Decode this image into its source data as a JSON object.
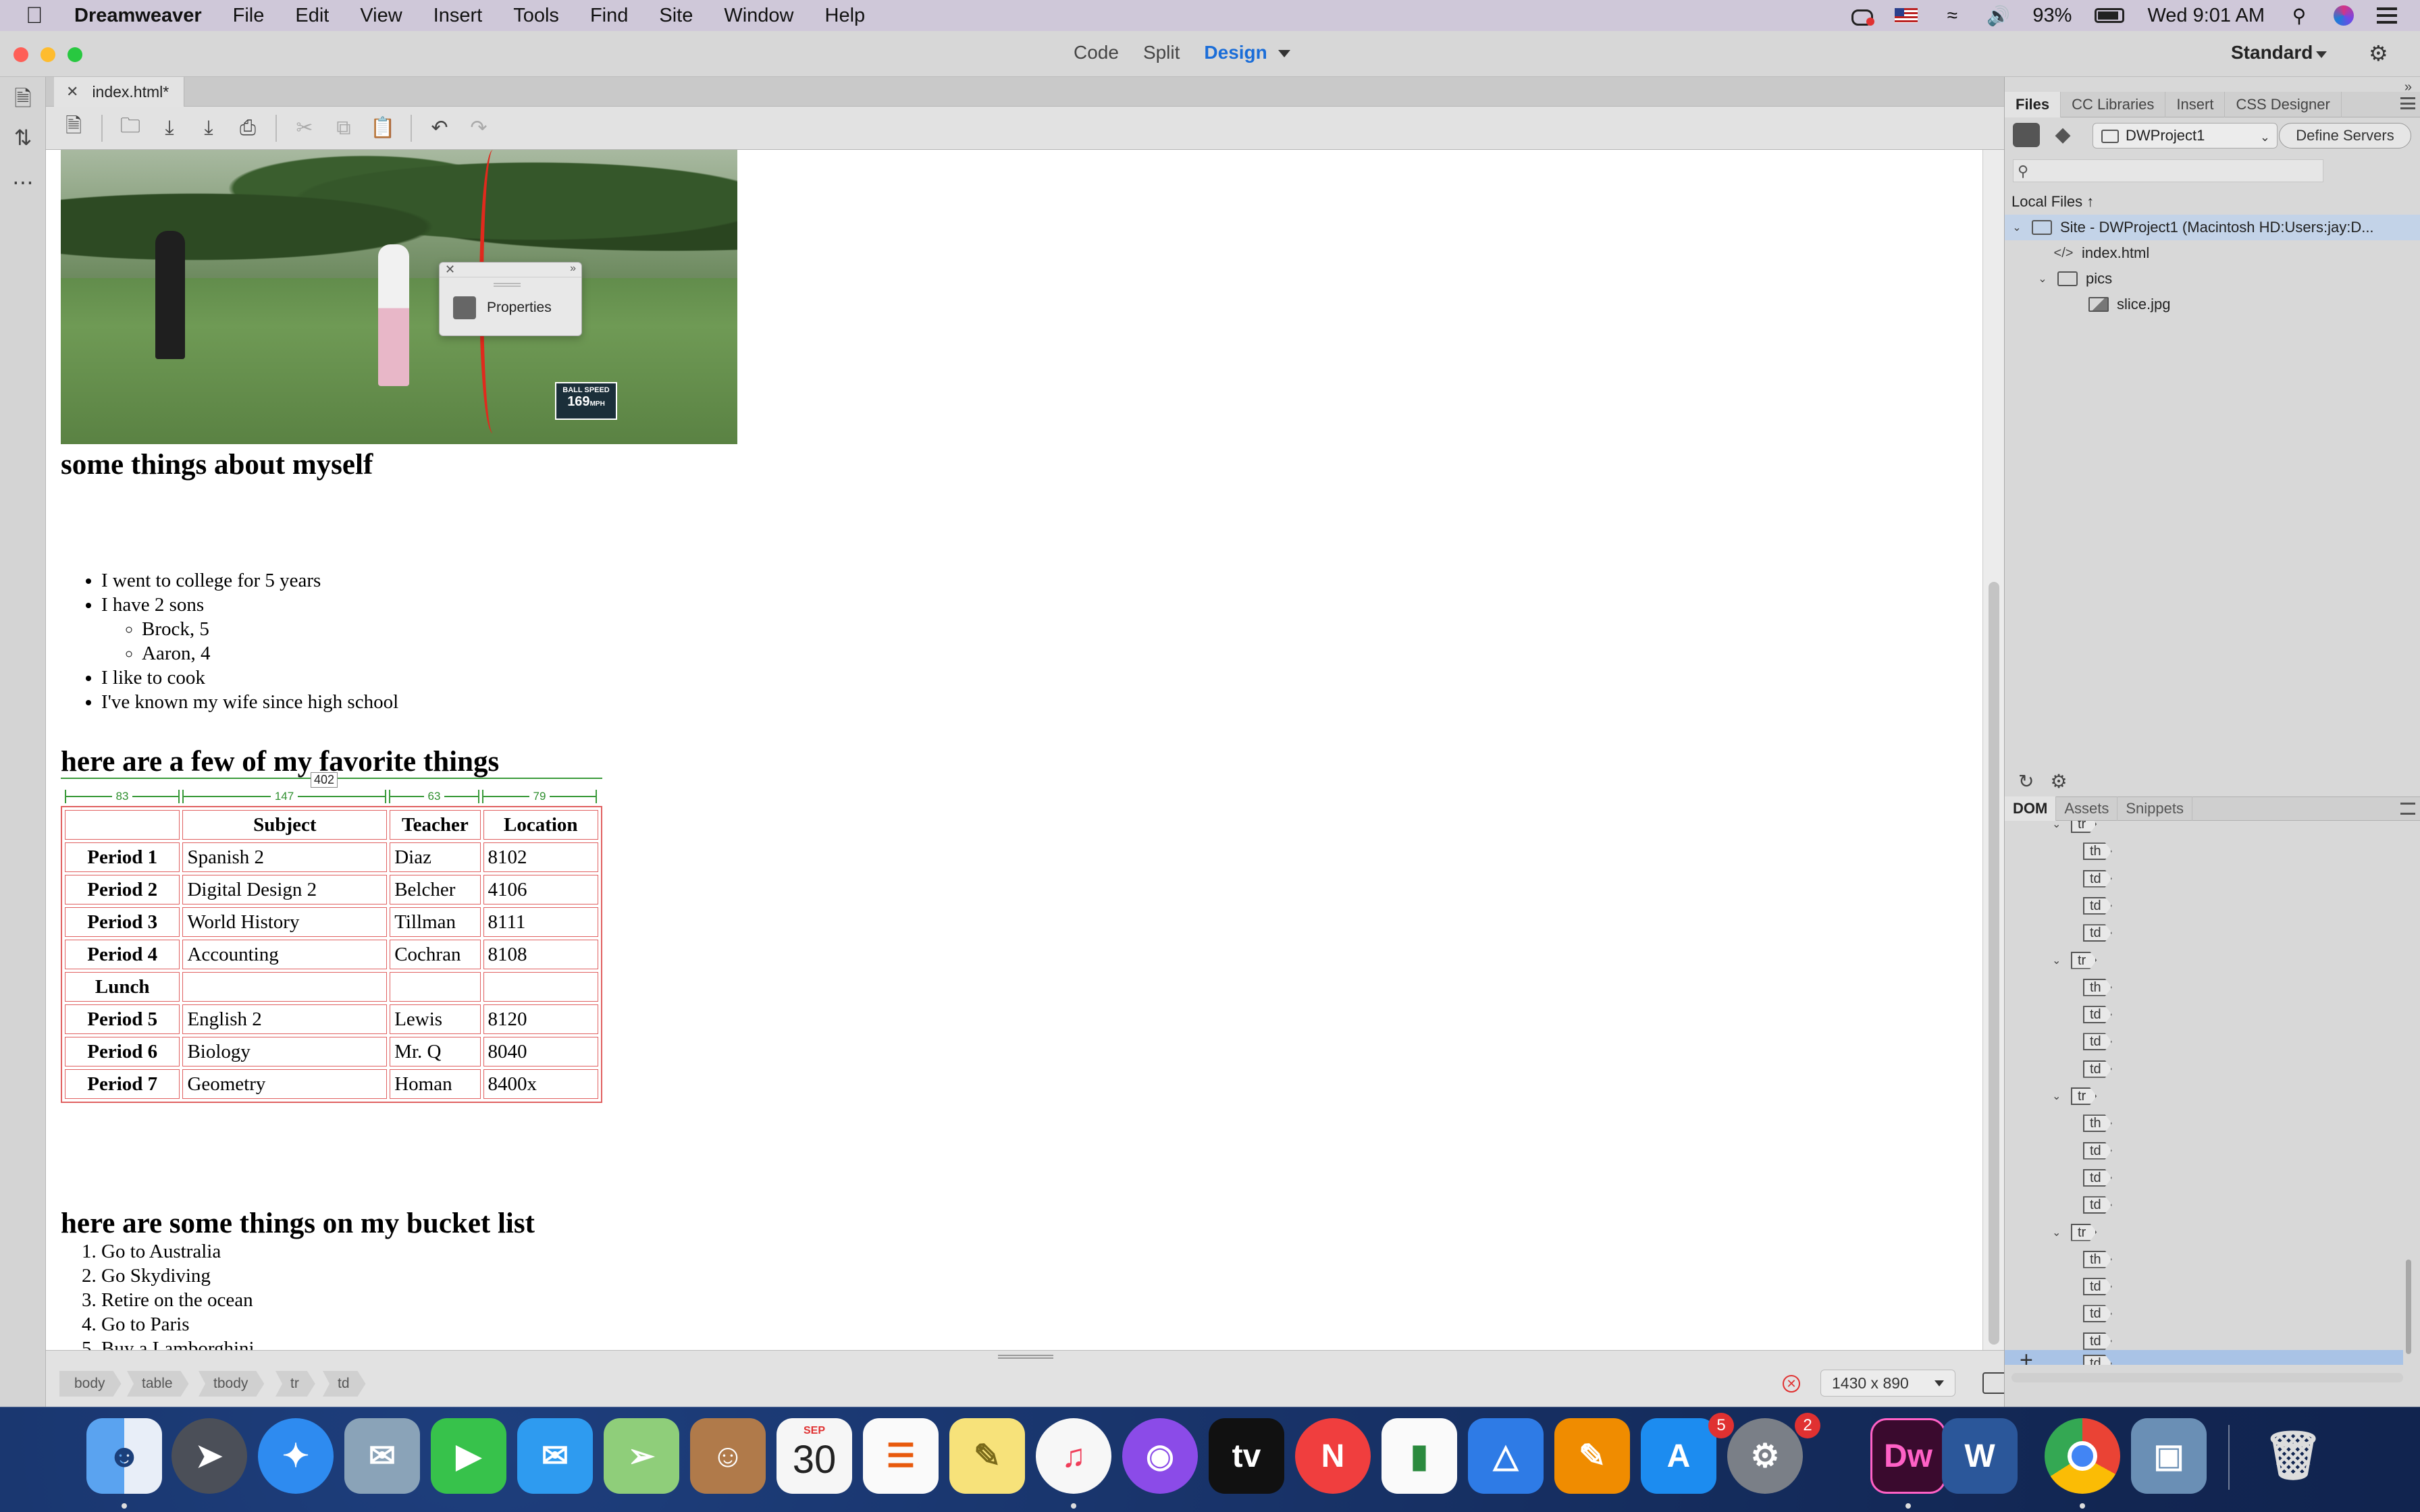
{
  "menubar": {
    "app": "Dreamweaver",
    "items": [
      "File",
      "Edit",
      "View",
      "Insert",
      "Tools",
      "Find",
      "Site",
      "Window",
      "Help"
    ],
    "battery": "93%",
    "clock": "Wed 9:01 AM"
  },
  "titlebar": {
    "views": [
      "Code",
      "Split",
      "Design"
    ],
    "active_view": "Design",
    "workspace": "Standard"
  },
  "document": {
    "tab_label": "index.html*",
    "photo": {
      "speed_label": "BALL SPEED",
      "speed_value": "169",
      "speed_unit": "MPH"
    },
    "properties_label": "Properties",
    "heading1": "some things about myself",
    "about_list": [
      "I went to college for 5 years",
      "I have 2 sons",
      "Brock, 5",
      "Aaron, 4",
      "I like to cook",
      "I've known my wife since high school"
    ],
    "heading2": "here are a few of my favorite things",
    "table_guide": {
      "total": "402",
      "col_widths": [
        "83",
        "147",
        "63",
        "79"
      ]
    },
    "table": {
      "headers": [
        "",
        "Subject",
        "Teacher",
        "Location"
      ],
      "rows": [
        [
          "Period 1",
          "Spanish 2",
          "Diaz",
          "8102"
        ],
        [
          "Period 2",
          "Digital Design 2",
          "Belcher",
          "4106"
        ],
        [
          "Period 3",
          "World History",
          "Tillman",
          "8111"
        ],
        [
          "Period 4",
          "Accounting",
          "Cochran",
          "8108"
        ],
        [
          "Lunch",
          "",
          "",
          ""
        ],
        [
          "Period 5",
          "English 2",
          "Lewis",
          "8120"
        ],
        [
          "Period 6",
          "Biology",
          "Mr. Q",
          "8040"
        ],
        [
          "Period 7",
          "Geometry",
          "Homan",
          "8400x"
        ]
      ]
    },
    "heading3": "here are some things on my bucket list",
    "bucket_list": [
      "Go to Australia",
      "Go Skydiving",
      "Retire on the ocean",
      "Go to Paris",
      "Buy a Lamborghini"
    ]
  },
  "tagbar": {
    "tags": [
      "body",
      "table",
      "tbody",
      "tr",
      "td"
    ],
    "window_size": "1430 x 890"
  },
  "right_panel": {
    "tabs": [
      "Files",
      "CC Libraries",
      "Insert",
      "CSS Designer"
    ],
    "active_tab": "Files",
    "site_select": "DWProject1",
    "define_servers": "Define Servers",
    "local_files": "Local Files",
    "tree": [
      {
        "label": "Site - DWProject1 (Macintosh HD:Users:jay:D..."
      },
      {
        "label": "index.html"
      },
      {
        "label": "pics"
      },
      {
        "label": "slice.jpg"
      }
    ],
    "dom_tabs": [
      "DOM",
      "Assets",
      "Snippets"
    ],
    "dom_active": "DOM",
    "dom_nodes": [
      "tr",
      "th",
      "td",
      "td",
      "td",
      "tr",
      "th",
      "td",
      "td",
      "td",
      "tr",
      "th",
      "td",
      "td",
      "td",
      "tr",
      "th",
      "td",
      "td",
      "td"
    ]
  },
  "dock": {
    "calendar_month": "SEP",
    "calendar_day": "30",
    "appstore_badge": "5",
    "prefs_badge": "2",
    "dw_label": "Dw",
    "word_label": "W",
    "tv_label": "tv"
  }
}
